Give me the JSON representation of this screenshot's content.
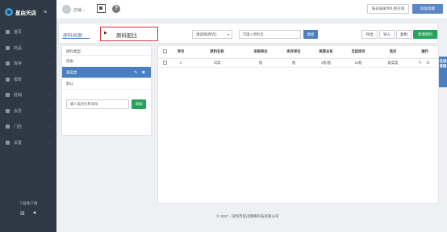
{
  "sidebar": {
    "brand": "星由天店",
    "menu_toggle": "≡",
    "items": [
      {
        "label": "首页",
        "icon": "home-icon"
      },
      {
        "label": "商品",
        "icon": "goods-icon"
      },
      {
        "label": "库存",
        "icon": "inventory-icon"
      },
      {
        "label": "报表",
        "icon": "report-icon"
      },
      {
        "label": "经销",
        "icon": "dealer-icon"
      },
      {
        "label": "会员",
        "icon": "member-icon"
      },
      {
        "label": "门店",
        "icon": "store-icon"
      },
      {
        "label": "设置",
        "icon": "settings-icon"
      }
    ],
    "download_label": "下载客户端",
    "download_icons": [
      "windows-icon",
      "apple-icon"
    ]
  },
  "header": {
    "username": "店铺",
    "help": "?",
    "outline_button": "报表偏离到扎根在线",
    "primary_button": "扣留高端"
  },
  "tabs": {
    "archive": "原料档案",
    "recipe_arrow": "▶",
    "recipe": "原料配比"
  },
  "filter": {
    "select_value": "请选择(所有)",
    "search_placeholder": "可输入原料名",
    "search_button": "搜索"
  },
  "actions": {
    "print": "导出",
    "import": "导入",
    "copy": "复制",
    "add": "新增原料"
  },
  "left_panel": {
    "header": "原料类型",
    "items": [
      {
        "label": "肉类",
        "active": false
      },
      {
        "label": "蔬菜类",
        "active": true
      },
      {
        "label": "默认",
        "active": false
      }
    ],
    "edit_icons": "✎ ✖",
    "input_placeholder": "输入类目名称添加",
    "add_button": "添加"
  },
  "table": {
    "headers": [
      "",
      "序号",
      "原料名称",
      "采购单位",
      "库存单位",
      "换算关系",
      "当前库存",
      "类目",
      "操作"
    ],
    "rows": [
      {
        "index": "1",
        "name": "白菜",
        "purchase_unit": "瓶",
        "stock_unit": "瓶",
        "conversion": "1瓶/瓶",
        "current_stock": "10瓶",
        "category": "蔬菜类",
        "ops": "✎ ⊡"
      }
    ]
  },
  "float_tab": "在线客服",
  "footer": "© 2017 - 深圳市思迅网络科技有限公司"
}
